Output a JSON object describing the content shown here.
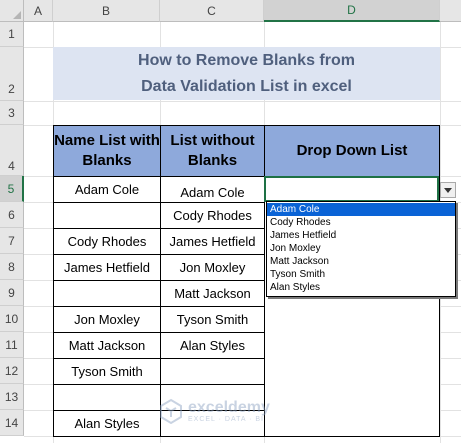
{
  "sheet": {
    "columns": [
      "A",
      "B",
      "C",
      "D"
    ],
    "rows": [
      "1",
      "2",
      "3",
      "4",
      "5",
      "6",
      "7",
      "8",
      "9",
      "10",
      "11",
      "12",
      "13",
      "14"
    ],
    "selected_column": "D",
    "selected_row": "5"
  },
  "title": {
    "line1": "How to Remove Blanks from",
    "line2": "Data Validation List in excel"
  },
  "table": {
    "header_b": "Name List with Blanks",
    "header_c": "List without Blanks",
    "header_d": "Drop Down List",
    "col_b": [
      "Adam Cole",
      "",
      "Cody Rhodes",
      "James Hetfield",
      "",
      "Jon Moxley",
      "Matt Jackson",
      "Tyson Smith",
      "",
      "Alan Styles"
    ],
    "col_c": [
      "Adam Cole",
      "Cody Rhodes",
      "James Hetfield",
      "Jon Moxley",
      "Matt Jackson",
      "Tyson Smith",
      "Alan Styles",
      "",
      "",
      ""
    ]
  },
  "dropdown": {
    "options": [
      "Adam Cole",
      "Cody Rhodes",
      "James Hetfield",
      "Jon Moxley",
      "Matt Jackson",
      "Tyson Smith",
      "Alan Styles"
    ],
    "highlighted": "Adam Cole",
    "accent_color": "#0a63d6"
  },
  "watermark": {
    "brand": "exceldemy",
    "tagline": "EXCEL · DATA · BI"
  },
  "colors": {
    "header_fill": "#8ea9db",
    "title_fill": "#dde4f2",
    "title_text": "#4f5f7d",
    "selection_green": "#217346"
  }
}
